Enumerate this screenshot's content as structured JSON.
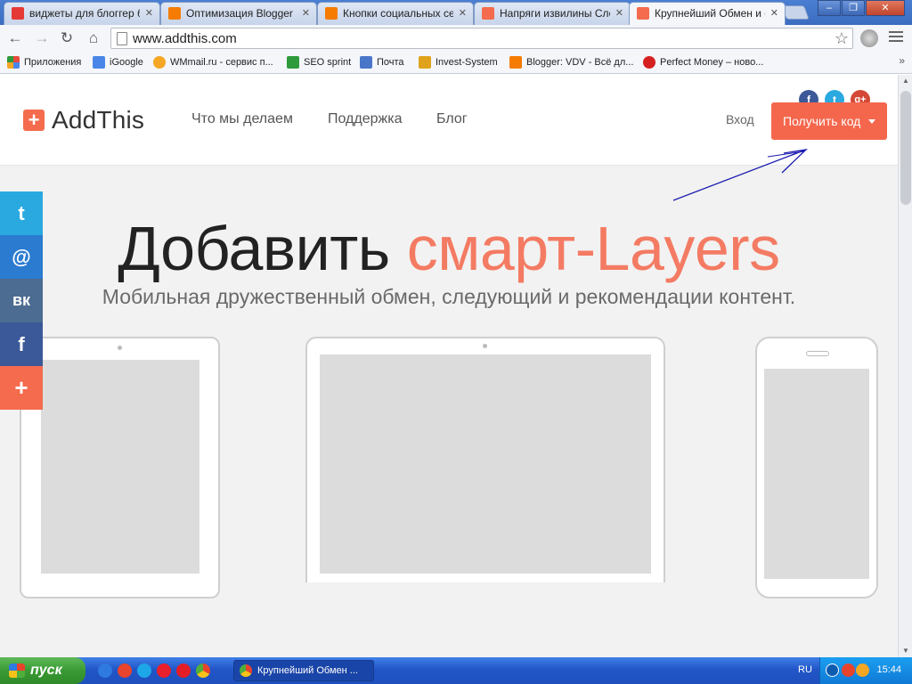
{
  "browser": {
    "tabs": [
      {
        "title": "виджеты для блоггер б",
        "favicon_color": "#e53935",
        "active": false
      },
      {
        "title": "Оптимизация Blogger",
        "favicon_color": "#f57c00",
        "active": false
      },
      {
        "title": "Кнопки социальных сет",
        "favicon_color": "#f57c00",
        "active": false
      },
      {
        "title": "Напряги извилины Слон",
        "favicon_color": "#f46b4d",
        "active": false
      },
      {
        "title": "Крупнейший Обмен и со",
        "favicon_color": "#f46b4d",
        "active": true
      }
    ],
    "window_controls": {
      "minimize": "–",
      "restore": "❐",
      "close": "✕"
    },
    "toolbar": {
      "back": "←",
      "forward": "→",
      "reload": "↻",
      "home": "⌂",
      "star": "☆"
    },
    "url": "www.addthis.com",
    "bookmarks": [
      {
        "label": "Приложения",
        "icon_color": "#e84b3c"
      },
      {
        "label": "iGoogle",
        "icon_color": "#4a86e8"
      },
      {
        "label": "WMmail.ru - сервис п...",
        "icon_color": "#f5a623"
      },
      {
        "label": "SEO sprint",
        "icon_color": "#2e9a3c"
      },
      {
        "label": "Почта",
        "icon_color": "#4a76c9"
      },
      {
        "label": "Invest-System",
        "icon_color": "#e0a21a"
      },
      {
        "label": "Blogger: VDV - Всё дл...",
        "icon_color": "#f57c00"
      },
      {
        "label": "Perfect Money – ново...",
        "icon_color": "#d62020"
      }
    ],
    "bookmarks_more": "»"
  },
  "site": {
    "logo_mark": "+",
    "logo_text": "AddThis",
    "nav": [
      "Что мы делаем",
      "Поддержка",
      "Блог"
    ],
    "login": "Вход",
    "get_code": "Получить код",
    "header_social": [
      {
        "glyph": "f",
        "color": "#3b5998"
      },
      {
        "glyph": "t",
        "color": "#2aa9e0"
      },
      {
        "glyph": "g+",
        "color": "#d34836"
      }
    ],
    "hero": {
      "title_part1": "Добавить ",
      "title_part2": "смарт",
      "title_part3": "-Layers",
      "subtitle": "Мобильная дружественный обмен, следующий и рекомендации контент."
    },
    "share_bar": [
      {
        "name": "twitter",
        "glyph": "t",
        "color": "#2aa9e0"
      },
      {
        "name": "mail",
        "glyph": "@",
        "color": "#2b7bd0"
      },
      {
        "name": "vk",
        "glyph": "вк",
        "color": "#4c6c91"
      },
      {
        "name": "facebook",
        "glyph": "f",
        "color": "#3b5998"
      },
      {
        "name": "more",
        "glyph": "+",
        "color": "#f46b4d"
      }
    ],
    "accent_color": "#f4674d"
  },
  "taskbar": {
    "start": "пуск",
    "active_window": "Крупнейший Обмен ...",
    "lang": "RU",
    "clock": "15:44"
  }
}
